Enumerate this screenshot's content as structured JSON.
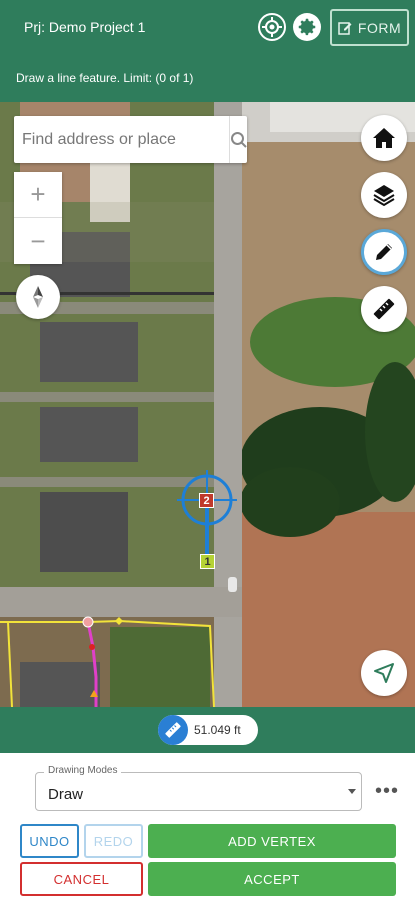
{
  "header": {
    "project": "Prj: Demo Project 1",
    "instruction": "Draw a line feature. Limit: (0 of 1)",
    "form_label": "FORM"
  },
  "search": {
    "placeholder": "Find address or place"
  },
  "zoom": {
    "in": "+",
    "out": "−"
  },
  "map": {
    "vertex_labels": [
      "2",
      "1"
    ]
  },
  "measurement": {
    "value": "51.049 ft"
  },
  "drawing": {
    "legend": "Drawing Modes",
    "mode": "Draw",
    "more": "•••"
  },
  "buttons": {
    "undo": "UNDO",
    "redo": "REDO",
    "add_vertex": "ADD VERTEX",
    "cancel": "CANCEL",
    "accept": "ACCEPT"
  },
  "colors": {
    "header_green": "#2f7d5c",
    "action_green": "#4caf50",
    "undo_blue": "#2f87c8",
    "cancel_red": "#d32f2f",
    "crosshair_blue": "#1e7fd6"
  }
}
